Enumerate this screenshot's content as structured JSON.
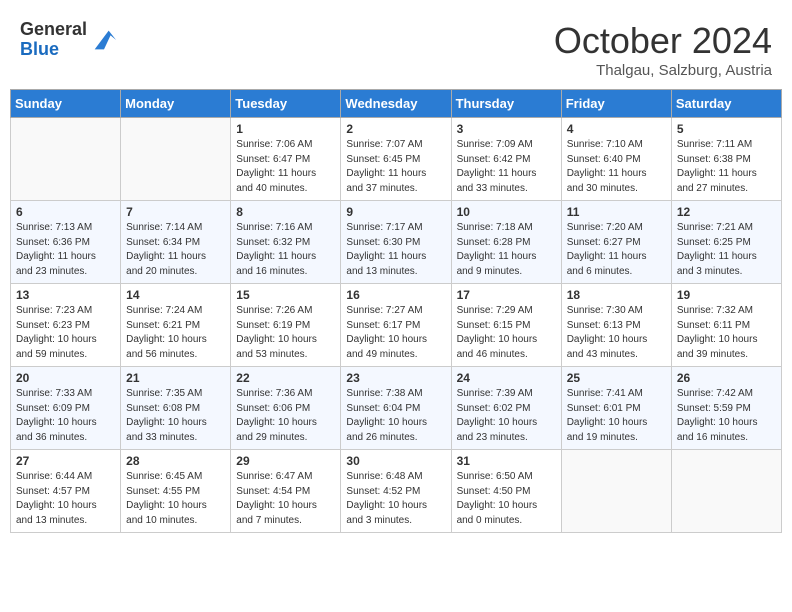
{
  "header": {
    "logo_general": "General",
    "logo_blue": "Blue",
    "month_title": "October 2024",
    "subtitle": "Thalgau, Salzburg, Austria"
  },
  "days_of_week": [
    "Sunday",
    "Monday",
    "Tuesday",
    "Wednesday",
    "Thursday",
    "Friday",
    "Saturday"
  ],
  "weeks": [
    [
      {
        "day": "",
        "info": ""
      },
      {
        "day": "",
        "info": ""
      },
      {
        "day": "1",
        "info": "Sunrise: 7:06 AM\nSunset: 6:47 PM\nDaylight: 11 hours and 40 minutes."
      },
      {
        "day": "2",
        "info": "Sunrise: 7:07 AM\nSunset: 6:45 PM\nDaylight: 11 hours and 37 minutes."
      },
      {
        "day": "3",
        "info": "Sunrise: 7:09 AM\nSunset: 6:42 PM\nDaylight: 11 hours and 33 minutes."
      },
      {
        "day": "4",
        "info": "Sunrise: 7:10 AM\nSunset: 6:40 PM\nDaylight: 11 hours and 30 minutes."
      },
      {
        "day": "5",
        "info": "Sunrise: 7:11 AM\nSunset: 6:38 PM\nDaylight: 11 hours and 27 minutes."
      }
    ],
    [
      {
        "day": "6",
        "info": "Sunrise: 7:13 AM\nSunset: 6:36 PM\nDaylight: 11 hours and 23 minutes."
      },
      {
        "day": "7",
        "info": "Sunrise: 7:14 AM\nSunset: 6:34 PM\nDaylight: 11 hours and 20 minutes."
      },
      {
        "day": "8",
        "info": "Sunrise: 7:16 AM\nSunset: 6:32 PM\nDaylight: 11 hours and 16 minutes."
      },
      {
        "day": "9",
        "info": "Sunrise: 7:17 AM\nSunset: 6:30 PM\nDaylight: 11 hours and 13 minutes."
      },
      {
        "day": "10",
        "info": "Sunrise: 7:18 AM\nSunset: 6:28 PM\nDaylight: 11 hours and 9 minutes."
      },
      {
        "day": "11",
        "info": "Sunrise: 7:20 AM\nSunset: 6:27 PM\nDaylight: 11 hours and 6 minutes."
      },
      {
        "day": "12",
        "info": "Sunrise: 7:21 AM\nSunset: 6:25 PM\nDaylight: 11 hours and 3 minutes."
      }
    ],
    [
      {
        "day": "13",
        "info": "Sunrise: 7:23 AM\nSunset: 6:23 PM\nDaylight: 10 hours and 59 minutes."
      },
      {
        "day": "14",
        "info": "Sunrise: 7:24 AM\nSunset: 6:21 PM\nDaylight: 10 hours and 56 minutes."
      },
      {
        "day": "15",
        "info": "Sunrise: 7:26 AM\nSunset: 6:19 PM\nDaylight: 10 hours and 53 minutes."
      },
      {
        "day": "16",
        "info": "Sunrise: 7:27 AM\nSunset: 6:17 PM\nDaylight: 10 hours and 49 minutes."
      },
      {
        "day": "17",
        "info": "Sunrise: 7:29 AM\nSunset: 6:15 PM\nDaylight: 10 hours and 46 minutes."
      },
      {
        "day": "18",
        "info": "Sunrise: 7:30 AM\nSunset: 6:13 PM\nDaylight: 10 hours and 43 minutes."
      },
      {
        "day": "19",
        "info": "Sunrise: 7:32 AM\nSunset: 6:11 PM\nDaylight: 10 hours and 39 minutes."
      }
    ],
    [
      {
        "day": "20",
        "info": "Sunrise: 7:33 AM\nSunset: 6:09 PM\nDaylight: 10 hours and 36 minutes."
      },
      {
        "day": "21",
        "info": "Sunrise: 7:35 AM\nSunset: 6:08 PM\nDaylight: 10 hours and 33 minutes."
      },
      {
        "day": "22",
        "info": "Sunrise: 7:36 AM\nSunset: 6:06 PM\nDaylight: 10 hours and 29 minutes."
      },
      {
        "day": "23",
        "info": "Sunrise: 7:38 AM\nSunset: 6:04 PM\nDaylight: 10 hours and 26 minutes."
      },
      {
        "day": "24",
        "info": "Sunrise: 7:39 AM\nSunset: 6:02 PM\nDaylight: 10 hours and 23 minutes."
      },
      {
        "day": "25",
        "info": "Sunrise: 7:41 AM\nSunset: 6:01 PM\nDaylight: 10 hours and 19 minutes."
      },
      {
        "day": "26",
        "info": "Sunrise: 7:42 AM\nSunset: 5:59 PM\nDaylight: 10 hours and 16 minutes."
      }
    ],
    [
      {
        "day": "27",
        "info": "Sunrise: 6:44 AM\nSunset: 4:57 PM\nDaylight: 10 hours and 13 minutes."
      },
      {
        "day": "28",
        "info": "Sunrise: 6:45 AM\nSunset: 4:55 PM\nDaylight: 10 hours and 10 minutes."
      },
      {
        "day": "29",
        "info": "Sunrise: 6:47 AM\nSunset: 4:54 PM\nDaylight: 10 hours and 7 minutes."
      },
      {
        "day": "30",
        "info": "Sunrise: 6:48 AM\nSunset: 4:52 PM\nDaylight: 10 hours and 3 minutes."
      },
      {
        "day": "31",
        "info": "Sunrise: 6:50 AM\nSunset: 4:50 PM\nDaylight: 10 hours and 0 minutes."
      },
      {
        "day": "",
        "info": ""
      },
      {
        "day": "",
        "info": ""
      }
    ]
  ]
}
